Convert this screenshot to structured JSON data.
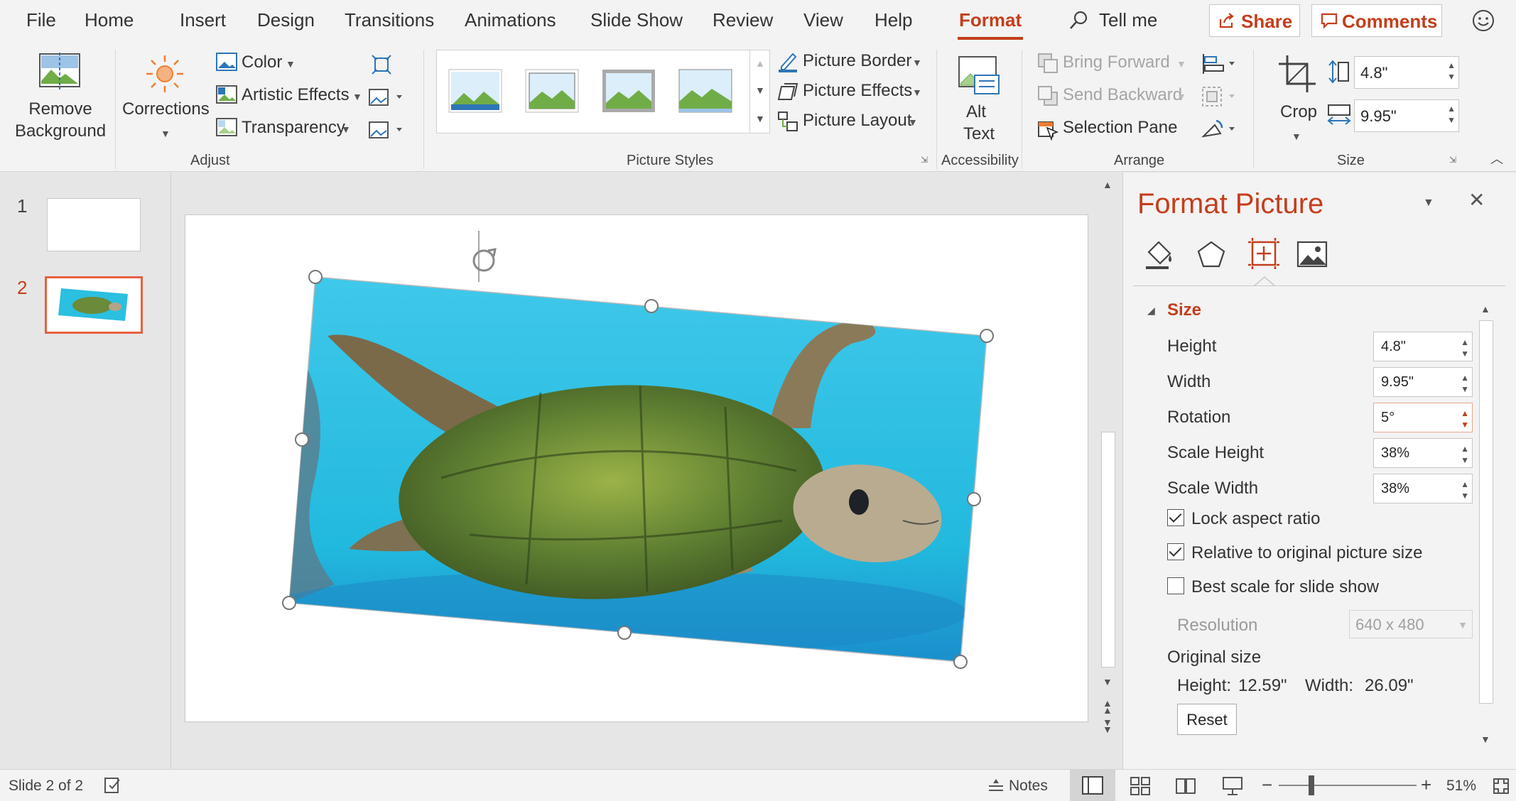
{
  "tabs": [
    "File",
    "Home",
    "Insert",
    "Design",
    "Transitions",
    "Animations",
    "Slide Show",
    "Review",
    "View",
    "Help",
    "Format"
  ],
  "tell_me": "Tell me",
  "share": "Share",
  "comments": "Comments",
  "ribbon": {
    "remove_background": [
      "Remove",
      "Background"
    ],
    "corrections": "Corrections",
    "color": "Color",
    "artistic_effects": "Artistic Effects",
    "transparency": "Transparency",
    "picture_border": "Picture Border",
    "picture_effects": "Picture Effects",
    "picture_layout": "Picture Layout",
    "alt_text": [
      "Alt",
      "Text"
    ],
    "bring_forward": "Bring Forward",
    "send_backward": "Send Backward",
    "selection_pane": "Selection Pane",
    "crop": "Crop",
    "height_value": "4.8\"",
    "width_value": "9.95\"",
    "groups": {
      "adjust": "Adjust",
      "picture_styles": "Picture Styles",
      "accessibility": "Accessibility",
      "arrange": "Arrange",
      "size": "Size"
    }
  },
  "slides": [
    {
      "number": "1"
    },
    {
      "number": "2"
    }
  ],
  "pane": {
    "title": "Format Picture",
    "section": "Size",
    "fields": [
      {
        "label": "Height",
        "value": "4.8\""
      },
      {
        "label": "Width",
        "value": "9.95\""
      },
      {
        "label": "Rotation",
        "value": "5°"
      },
      {
        "label": "Scale Height",
        "value": "38%"
      },
      {
        "label": "Scale Width",
        "value": "38%"
      }
    ],
    "lock_aspect": "Lock aspect ratio",
    "relative_size": "Relative to original picture size",
    "best_scale": "Best scale for slide show",
    "resolution_label": "Resolution",
    "resolution_value": "640 x 480",
    "original_size": "Original size",
    "orig_height_label": "Height:",
    "orig_height": "12.59\"",
    "orig_width_label": "Width:",
    "orig_width": "26.09\"",
    "reset": "Reset"
  },
  "status": {
    "slide_count": "Slide 2 of 2",
    "notes": "Notes",
    "zoom": "51%"
  },
  "colors": {
    "accent": "#c43e1c",
    "picture_water": "#2bbfe0"
  }
}
